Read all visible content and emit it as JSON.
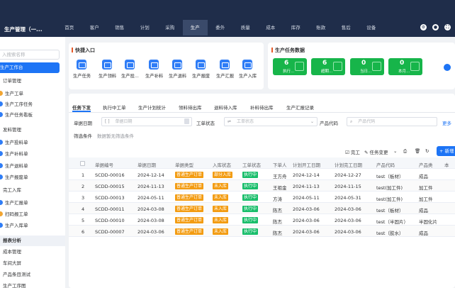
{
  "app_title": "生产管理（一...",
  "nav": [
    "首页",
    "客户",
    "销售",
    "计划",
    "采购",
    "生产",
    "委外",
    "质量",
    "成本",
    "库存",
    "账款",
    "售后",
    "设备"
  ],
  "nav_active": "生产",
  "sidebar": {
    "search_placeholder": "入搜索名称",
    "items": [
      {
        "label": "生产工作台",
        "active": true,
        "icon": "",
        "group": false
      },
      {
        "label": "订单管理",
        "active": false,
        "icon": "",
        "group": false
      },
      {
        "label": "生产工单",
        "active": false,
        "icon": "#f2a531",
        "group": false
      },
      {
        "label": "生产工序任务",
        "active": false,
        "icon": "#2f7df6",
        "group": false
      },
      {
        "label": "生产任务看板",
        "active": false,
        "icon": "#2f7df6",
        "group": false
      },
      {
        "label": "发料管理",
        "active": false,
        "icon": "",
        "group": false
      },
      {
        "label": "生产投料单",
        "active": false,
        "icon": "#2f7df6",
        "group": false
      },
      {
        "label": "生产补料单",
        "active": false,
        "icon": "#2f7df6",
        "group": false
      },
      {
        "label": "生产退料单",
        "active": false,
        "icon": "#2f7df6",
        "group": false
      },
      {
        "label": "生产报废单",
        "active": false,
        "icon": "#2f7df6",
        "group": false
      },
      {
        "label": "完工入库",
        "active": false,
        "icon": "",
        "group": false
      },
      {
        "label": "生产汇报单",
        "active": false,
        "icon": "#2f7df6",
        "group": false
      },
      {
        "label": "扫码报工单",
        "active": false,
        "icon": "#f2a531",
        "group": false
      },
      {
        "label": "生产入库单",
        "active": false,
        "icon": "#2f7df6",
        "group": false
      },
      {
        "label": "报表分析",
        "active": false,
        "icon": "",
        "group": true
      },
      {
        "label": "成本管理",
        "active": false,
        "icon": "",
        "group": false
      },
      {
        "label": "车间大屏",
        "active": false,
        "icon": "",
        "group": false
      },
      {
        "label": "产品条目测试",
        "active": false,
        "icon": "",
        "group": false
      },
      {
        "label": "生产工序图",
        "active": false,
        "icon": "",
        "group": false
      }
    ]
  },
  "quick_entry": {
    "title": "快捷入口",
    "items": [
      "生产任务",
      "生产领料",
      "生产投...",
      "生产补料",
      "生产退料",
      "生产报废",
      "生产汇报",
      "生产入库"
    ]
  },
  "task_data": {
    "title": "生产任务数据",
    "stats": [
      {
        "num": "6",
        "label": "执行..."
      },
      {
        "num": "6",
        "label": "超期..."
      },
      {
        "num": "0",
        "label": "当日..."
      },
      {
        "num": "0",
        "label": "本月..."
      }
    ]
  },
  "tabs": [
    "任务下发",
    "执行中工单",
    "生产计划统计",
    "领料待出库",
    "退料待入库",
    "补料待出库",
    "生产汇报记录"
  ],
  "tabs_active": "任务下发",
  "filter": {
    "date_label": "单据日期",
    "date_placeholder": "单据日期",
    "status_label": "工单状态",
    "status_placeholder": "工单状态",
    "code_label": "产品代码",
    "code_placeholder": "产品代码",
    "more": "更多",
    "cond_label": "筛选条件",
    "cond_text": "数据暂无筛选条件"
  },
  "toolbar": {
    "finish": "完工",
    "change": "任务变更",
    "add": "+ 新增"
  },
  "table": {
    "headers": [
      "单据编号",
      "单据日期",
      "单据类型",
      "入库状态",
      "工单状态",
      "下单人",
      "计划开工日期",
      "计划完工日期",
      "产品代码",
      "产品类",
      "本"
    ],
    "rows": [
      {
        "no": "1",
        "code": "SCDD-00016",
        "date": "2024-12-14",
        "type": "普通生产订单",
        "instock": "部分入库",
        "status": "执行中",
        "person": "王方舟",
        "start": "2024-12-14",
        "end": "2024-12-27",
        "product": "test（板材）",
        "cat": "成品"
      },
      {
        "no": "2",
        "code": "SCDD-00015",
        "date": "2024-11-13",
        "type": "普通生产订单",
        "instock": "未入库",
        "status": "执行中",
        "person": "王祖金",
        "start": "2024-11-13",
        "end": "2024-11-15",
        "product": "test(加工件)",
        "cat": "加工件"
      },
      {
        "no": "3",
        "code": "SCDD-00013",
        "date": "2024-05-11",
        "type": "普通生产订单",
        "instock": "未入库",
        "status": "执行中",
        "person": "方涛",
        "start": "2024-05-11",
        "end": "2024-05-31",
        "product": "test(加工件)",
        "cat": "加工件"
      },
      {
        "no": "4",
        "code": "SCDD-00011",
        "date": "2024-03-08",
        "type": "普通生产订单",
        "instock": "未入库",
        "status": "执行中",
        "person": "陈杰",
        "start": "2024-03-06",
        "end": "2024-03-06",
        "product": "test（板材）",
        "cat": "成品"
      },
      {
        "no": "5",
        "code": "SCDD-00010",
        "date": "2024-03-08",
        "type": "普通生产订单",
        "instock": "未入库",
        "status": "执行中",
        "person": "陈杰",
        "start": "2024-03-06",
        "end": "2024-03-06",
        "product": "test（半固片）",
        "cat": "半固化片"
      },
      {
        "no": "6",
        "code": "SCDD-00007",
        "date": "2024-03-06",
        "type": "普通生产订单",
        "instock": "未入库",
        "status": "执行中",
        "person": "陈杰",
        "start": "2024-03-06",
        "end": "2024-03-06",
        "product": "test（胶水）",
        "cat": "成品"
      }
    ]
  },
  "colors": {
    "topbar": "#1f2d4a",
    "accent": "#1d74f5",
    "tag_orange": "#f39c12",
    "tag_green": "#19be6b",
    "stat_green": "#17b54a"
  }
}
